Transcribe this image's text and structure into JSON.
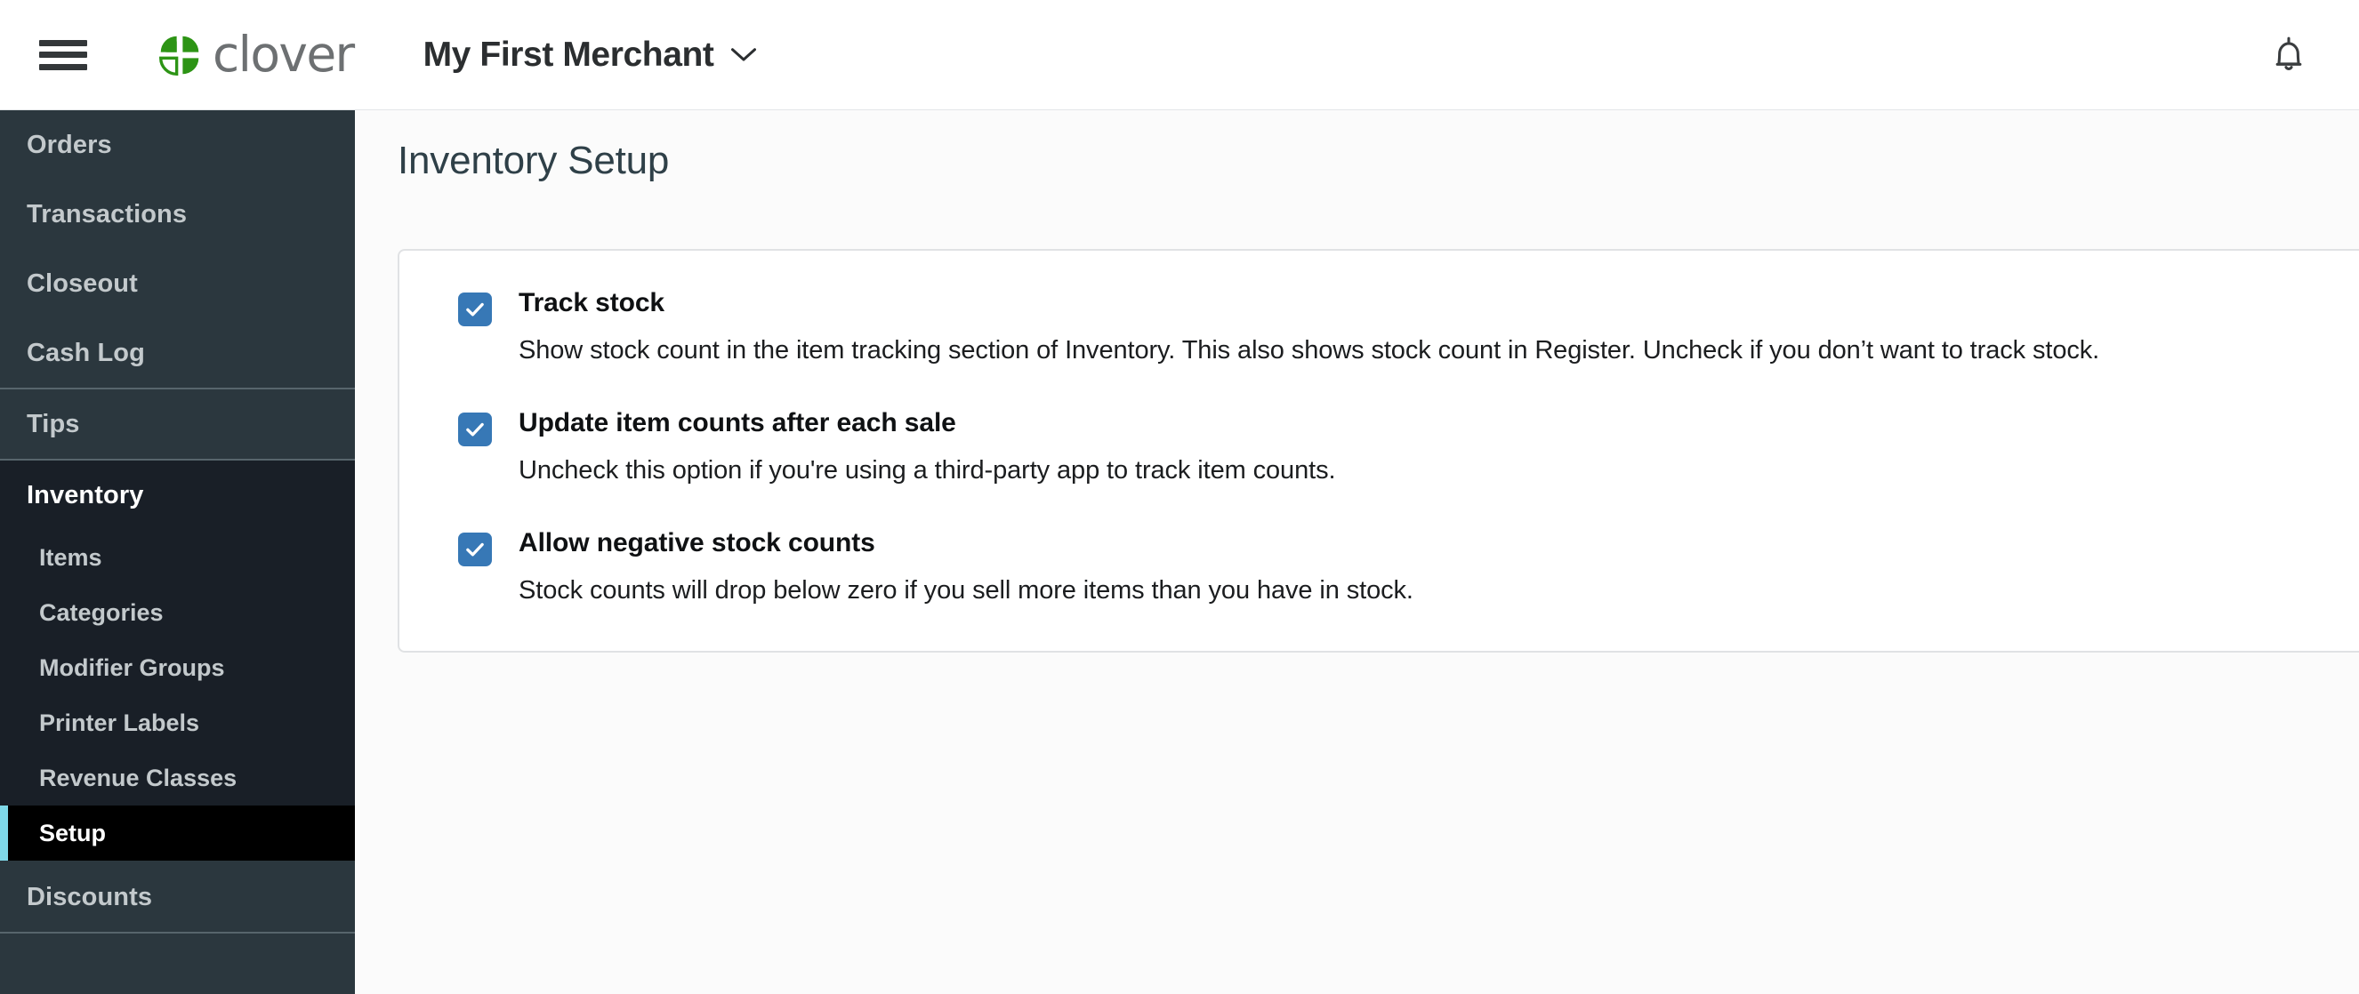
{
  "topbar": {
    "hamburger_icon": "hamburger-menu-icon",
    "brand": {
      "logo_icon": "clover-leaf-icon",
      "wordmark": "clover"
    },
    "merchant": {
      "name": "My First Merchant",
      "chevron_icon": "chevron-down-icon"
    },
    "notifications_icon": "bell-icon"
  },
  "sidebar": {
    "groups": [
      {
        "items": [
          {
            "label": "Orders"
          },
          {
            "label": "Transactions"
          },
          {
            "label": "Closeout"
          },
          {
            "label": "Cash Log"
          }
        ]
      },
      {
        "items": [
          {
            "label": "Tips"
          }
        ]
      },
      {
        "expanded": true,
        "parent": {
          "label": "Inventory"
        },
        "subitems": [
          {
            "label": "Items",
            "selected": false
          },
          {
            "label": "Categories",
            "selected": false
          },
          {
            "label": "Modifier Groups",
            "selected": false
          },
          {
            "label": "Printer Labels",
            "selected": false
          },
          {
            "label": "Revenue Classes",
            "selected": false
          },
          {
            "label": "Setup",
            "selected": true
          }
        ]
      },
      {
        "items": [
          {
            "label": "Discounts"
          }
        ]
      }
    ]
  },
  "main": {
    "page_title": "Inventory Setup",
    "settings": [
      {
        "checked": true,
        "label": "Track stock",
        "description": "Show stock count in the item tracking section of Inventory. This also shows stock count in Register. Uncheck if you don’t want to track stock."
      },
      {
        "checked": true,
        "label": "Update item counts after each sale",
        "description": "Uncheck this option if you're using a third-party app to track item counts."
      },
      {
        "checked": true,
        "label": "Allow negative stock counts",
        "description": "Stock counts will drop below zero if you sell more items than you have in stock."
      }
    ]
  },
  "colors": {
    "brand_green": "#2d9415",
    "sidebar_bg": "#2b373e",
    "sidebar_expanded_bg": "#191f27",
    "selected_accent": "#7fd8e8",
    "checkbox_blue": "#3778b6",
    "page_bg": "#fbfbfb",
    "title_color": "#2f4048"
  }
}
